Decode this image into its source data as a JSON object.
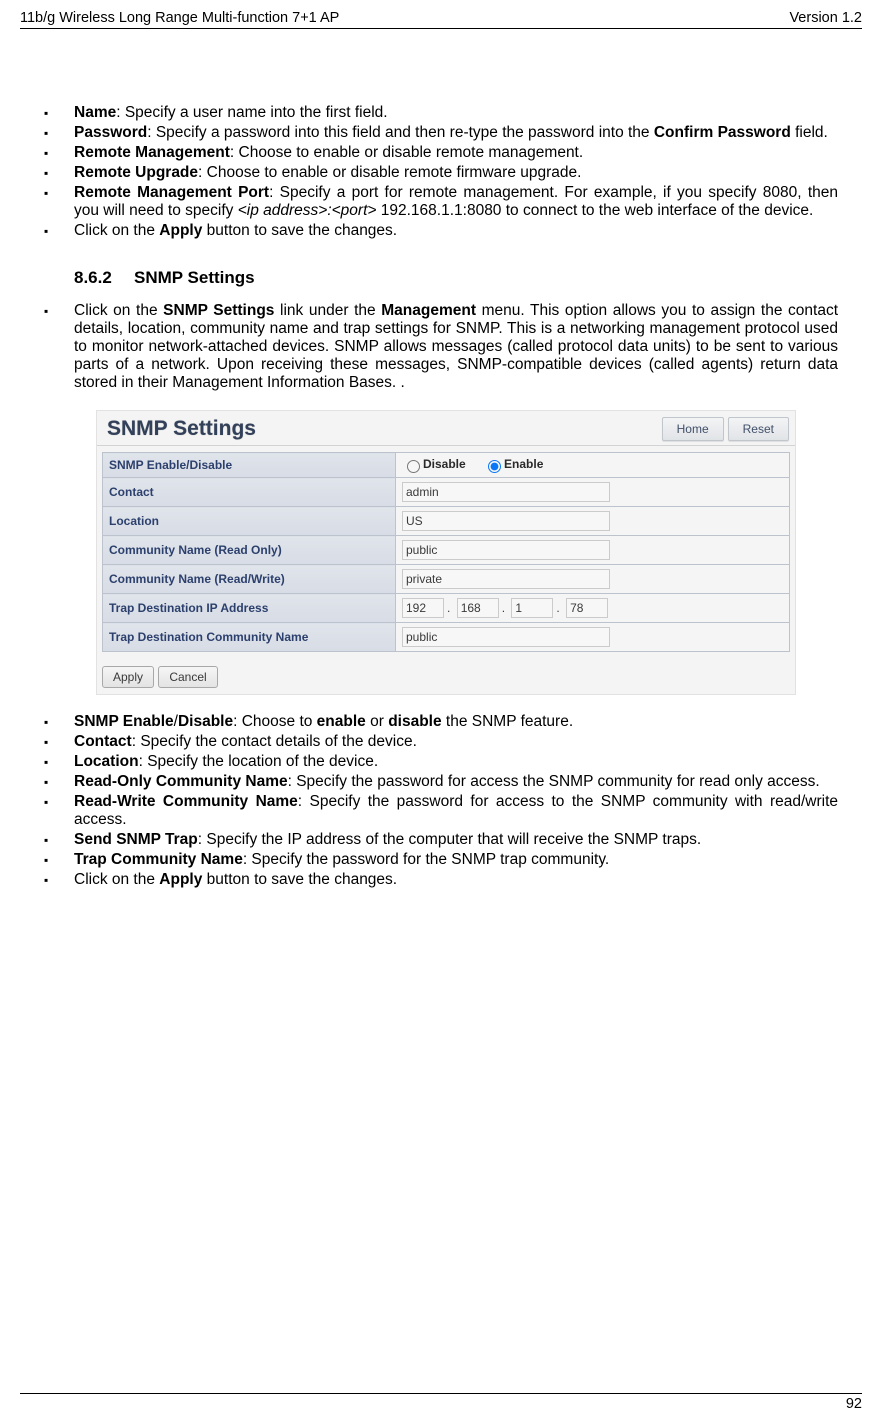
{
  "header": {
    "left": "11b/g Wireless Long Range Multi-function 7+1 AP",
    "right": "Version 1.2"
  },
  "footer": {
    "page": "92"
  },
  "section1": {
    "items": [
      {
        "bold": "Name",
        "rest": ": Specify a user name into the first field."
      },
      {
        "bold": "Password",
        "rest": ": Specify a password into this field and then re-type the password into the ",
        "bold2": "Confirm Password",
        "rest2": " field."
      },
      {
        "bold": "Remote Management",
        "rest": ": Choose to enable or disable remote management."
      },
      {
        "bold": "Remote Upgrade",
        "rest": ": Choose to enable or disable remote firmware upgrade."
      },
      {
        "bold": "Remote Management Port",
        "rest": ": Specify a port for remote management. For example, if you specify 8080, then you will need to specify ",
        "ital": "<ip address>:<port>",
        "rest2": " 192.168.1.1:8080 to connect to the web interface of the device."
      },
      {
        "pre": "Click on the ",
        "bold": "Apply",
        "rest": " button to save the changes."
      }
    ]
  },
  "heading862": {
    "num": "8.6.2",
    "title": "SNMP Settings"
  },
  "intro862": {
    "p1a": "Click on the ",
    "p1b": "SNMP Settings",
    "p1c": " link under the ",
    "p1d": "Management",
    "p1e": " menu. This option allows you to assign the contact details, location, community name and trap settings for SNMP. This is a networking management protocol used to monitor network-attached devices. SNMP allows messages (called protocol data units) to be sent to various parts of a network. Upon receiving these messages, SNMP-compatible devices (called agents) return data stored in their Management Information Bases. ."
  },
  "panel": {
    "title": "SNMP Settings",
    "home": "Home",
    "reset": "Reset",
    "rows": {
      "enable_label": "SNMP Enable/Disable",
      "disable": "Disable",
      "enable": "Enable",
      "contact_label": "Contact",
      "contact_val": "admin",
      "location_label": "Location",
      "location_val": "US",
      "ro_label": "Community Name (Read Only)",
      "ro_val": "public",
      "rw_label": "Community Name (Read/Write)",
      "rw_val": "private",
      "trapip_label": "Trap Destination IP Address",
      "ip1": "192",
      "ip2": "168",
      "ip3": "1",
      "ip4": "78",
      "trapcn_label": "Trap Destination Community Name",
      "trapcn_val": "public"
    },
    "apply": "Apply",
    "cancel": "Cancel"
  },
  "section3": {
    "items": [
      {
        "bold": "SNMP Enable",
        "slash": "/",
        "bold2": "Disable",
        "mid": ": Choose to ",
        "bold3": "enable",
        "or": " or ",
        "bold4": "disable",
        "end": " the SNMP feature."
      },
      {
        "bold": "Contact",
        "rest": ": Specify the contact details of the device."
      },
      {
        "bold": "Location",
        "rest": ": Specify the location of the device."
      },
      {
        "bold": "Read-Only Community Name",
        "rest": ": Specify the password for access the SNMP community for read only access."
      },
      {
        "bold": "Read-Write Community Name",
        "rest": ": Specify the password for access to the SNMP community with read/write access."
      },
      {
        "bold": "Send SNMP Trap",
        "rest": ": Specify the IP address of the computer that will receive the SNMP traps."
      },
      {
        "bold": "Trap Community Name",
        "rest": ": Specify the password for the SNMP trap community."
      },
      {
        "pre": "Click on the ",
        "bold": "Apply",
        "rest": " button to save the changes."
      }
    ]
  }
}
